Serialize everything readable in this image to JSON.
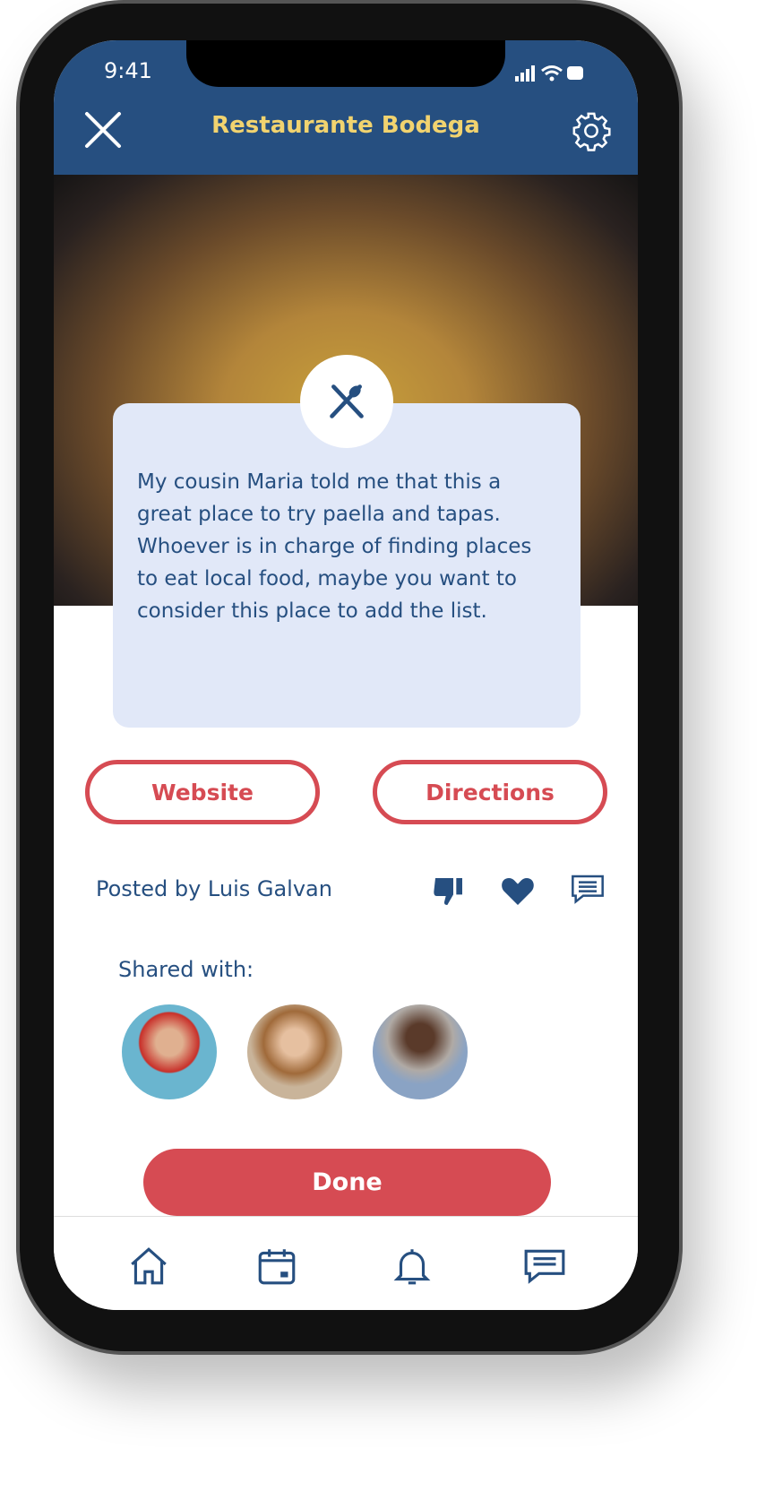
{
  "status": {
    "time": "9:41"
  },
  "header": {
    "title": "Restaurante Bodega",
    "close_icon": "close-icon",
    "settings_icon": "gear-icon"
  },
  "note": {
    "icon": "utensils-icon",
    "text": "My cousin Maria told me that this a great place to try paella and tapas. Whoever is in charge of finding places to eat local food, maybe you want to consider this place to add the list."
  },
  "buttons": {
    "website": "Website",
    "directions": "Directions",
    "done": "Done"
  },
  "post": {
    "posted_by": "Posted by Luis Galvan",
    "actions": [
      "thumbs-down-icon",
      "heart-icon",
      "comment-icon"
    ]
  },
  "shared": {
    "label": "Shared with:",
    "avatars": [
      "friend-1",
      "friend-2",
      "friend-3"
    ]
  },
  "tabs": [
    "home-icon",
    "calendar-icon",
    "bell-icon",
    "chat-icon"
  ],
  "colors": {
    "primary": "#264f80",
    "accent": "#d64b53",
    "title": "#f1d36f",
    "card": "#e1e8f8"
  }
}
